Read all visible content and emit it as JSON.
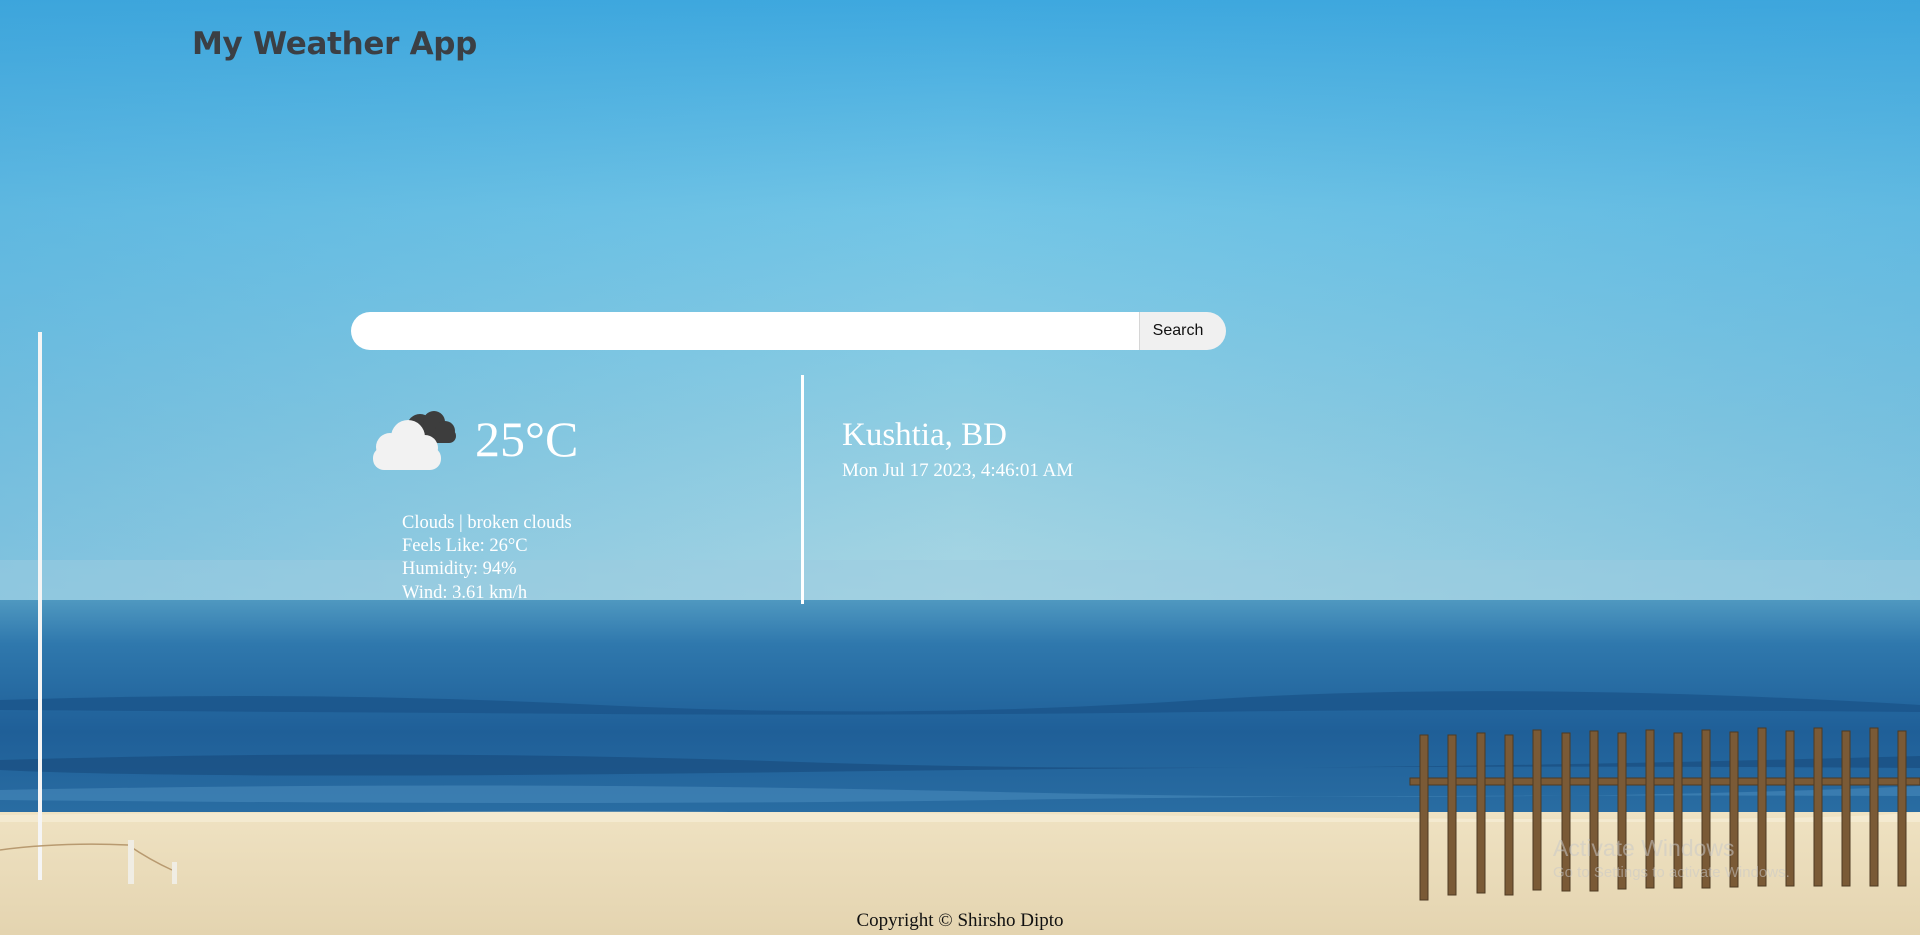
{
  "app": {
    "title": "My Weather App"
  },
  "search": {
    "value": "",
    "placeholder": "",
    "button_label": "Search"
  },
  "weather": {
    "icon": "cloud-icon",
    "temperature": "25°C",
    "condition": "Clouds | broken clouds",
    "feels_like": "Feels Like: 26°C",
    "humidity": "Humidity: 94%",
    "wind": "Wind: 3.61 km/h"
  },
  "location": {
    "name": "Kushtia, BD",
    "datetime": "Mon Jul 17 2023, 4:46:01 AM"
  },
  "watermark": {
    "title": "Activate Windows",
    "subtitle": "Go to Settings to activate Windows."
  },
  "footer": {
    "copyright": "Copyright © Shirsho Dipto"
  },
  "colors": {
    "title_text": "#3b3f44",
    "weather_text": "#ffffff",
    "sky_top": "#3da6dc",
    "sea": "#1d5f95",
    "sand": "#e9dcbd"
  }
}
